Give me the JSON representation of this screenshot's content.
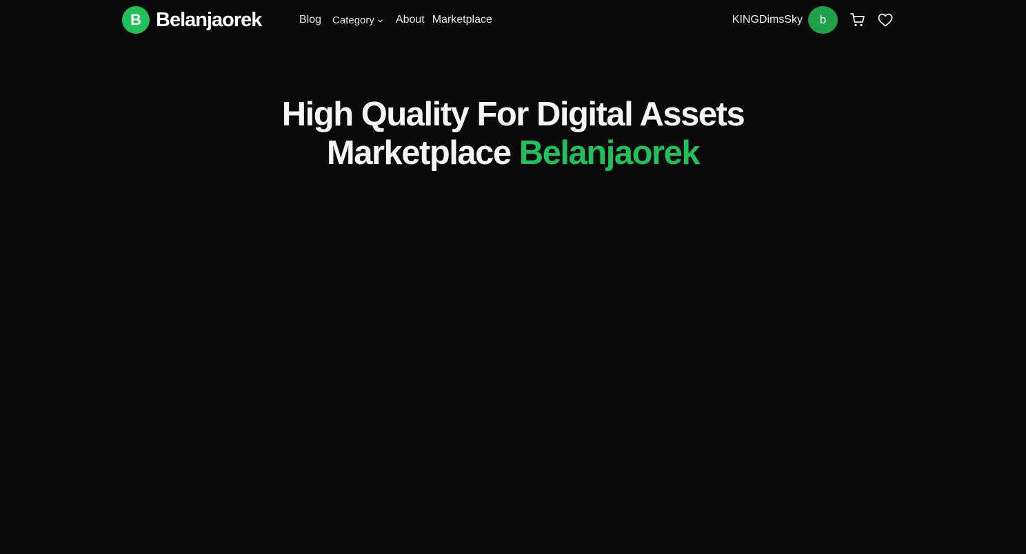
{
  "brand": {
    "badge_letter": "B",
    "name": "Belanjaorek",
    "accent_color": "#22c05a"
  },
  "nav": {
    "blog": "Blog",
    "category": "Category",
    "about": "About",
    "marketplace": "Marketplace"
  },
  "user": {
    "username": "KINGDimsSky",
    "avatar_letter": "b"
  },
  "icons": {
    "cart": "cart-icon",
    "wishlist": "heart-icon",
    "dropdown": "chevron-down-icon"
  },
  "hero": {
    "line1": "High Quality For Digital Assets",
    "line2_prefix": "Marketplace",
    "line2_accent": "Belanjaorek"
  },
  "colors": {
    "background": "#0b0a0a",
    "text": "#f5f5f5",
    "accent": "#22c05a"
  }
}
